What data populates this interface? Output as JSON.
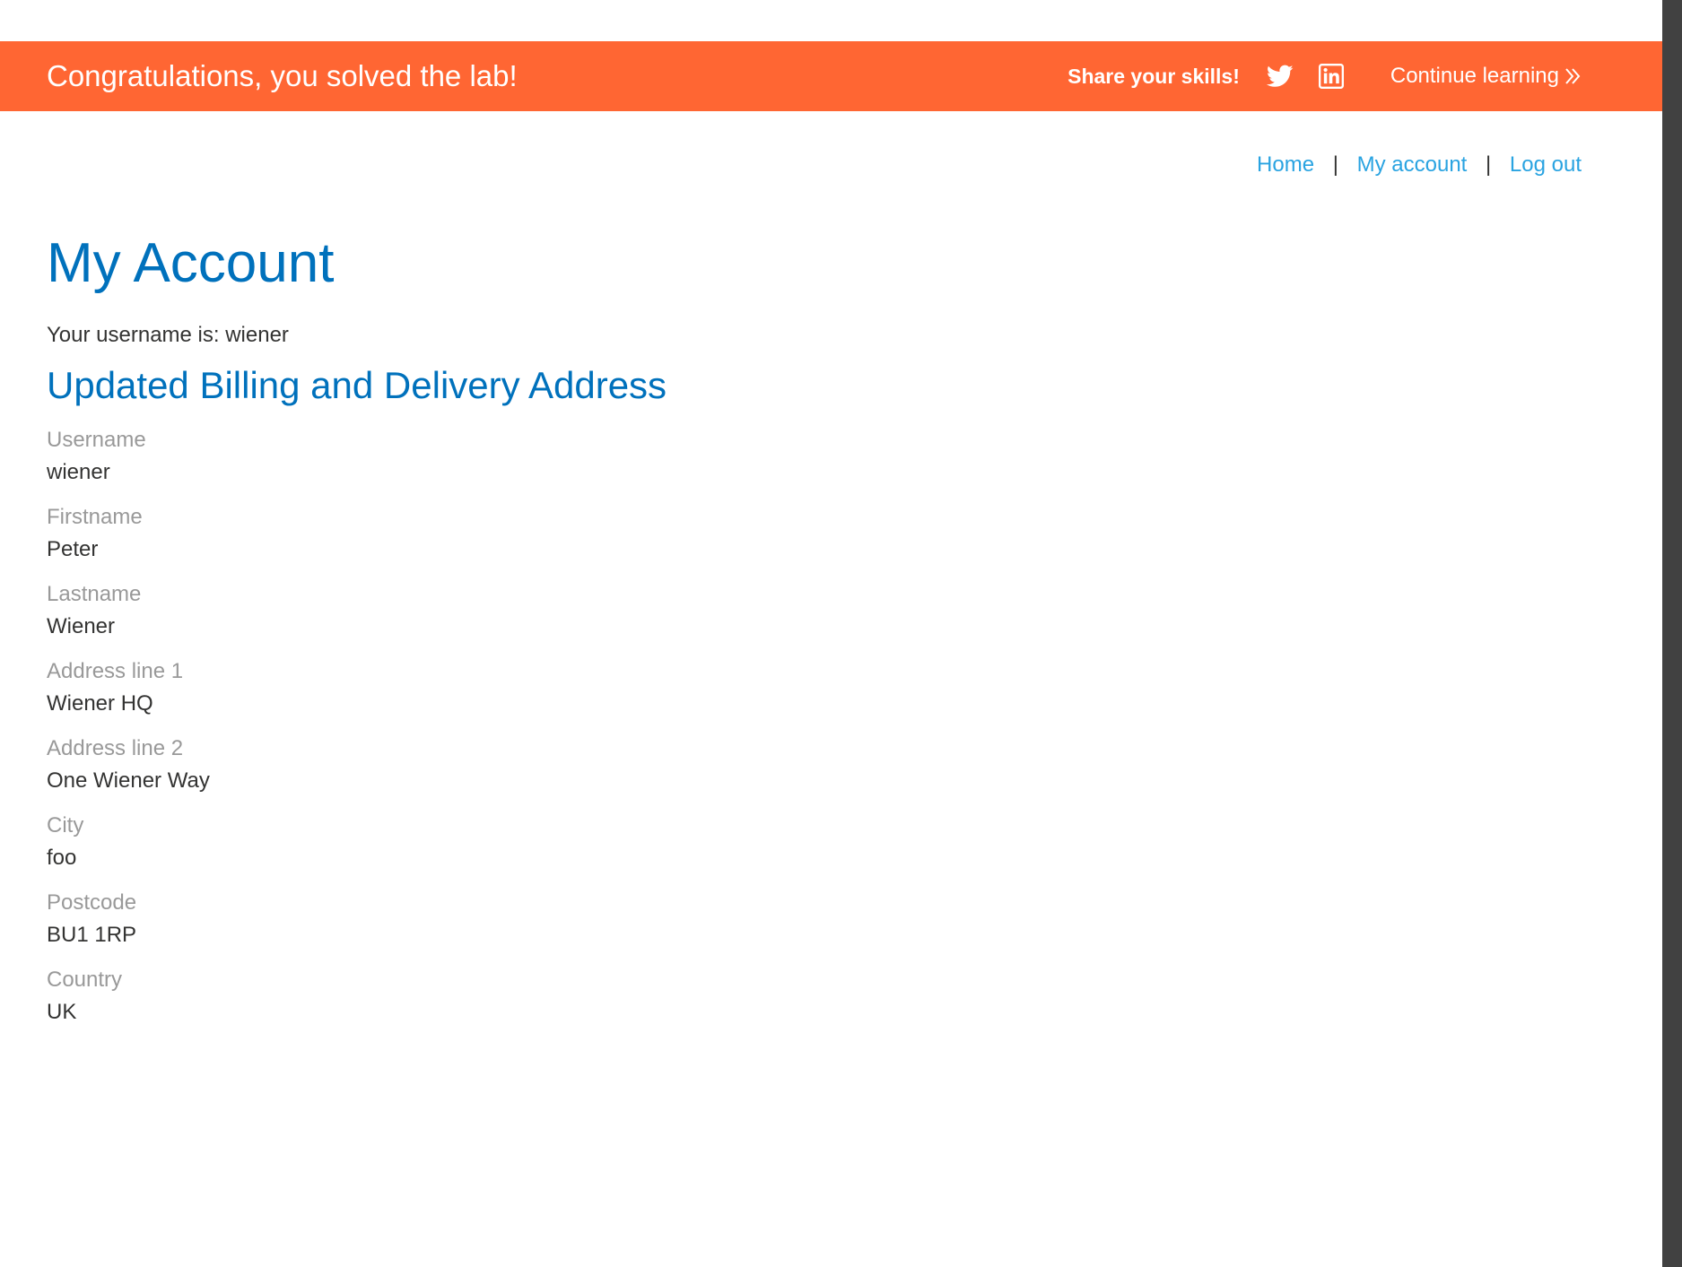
{
  "banner": {
    "title": "Congratulations, you solved the lab!",
    "share_text": "Share your skills!",
    "twitter_icon": "twitter-icon",
    "linkedin_icon": "linkedin-icon",
    "continue_label": "Continue learning",
    "continue_icon": "double-chevron-right-icon",
    "background_color": "#ff6633"
  },
  "nav": {
    "items": [
      {
        "label": "Home"
      },
      {
        "label": "My account"
      },
      {
        "label": "Log out"
      }
    ],
    "separator": "|",
    "link_color": "#29a3e1"
  },
  "main": {
    "page_title": "My Account",
    "username_line": "Your username is: wiener",
    "section_title": "Updated Billing and Delivery Address",
    "heading_color": "#0071bc",
    "fields": [
      {
        "label": "Username",
        "value": "wiener"
      },
      {
        "label": "Firstname",
        "value": "Peter"
      },
      {
        "label": "Lastname",
        "value": "Wiener"
      },
      {
        "label": "Address line 1",
        "value": "Wiener HQ"
      },
      {
        "label": "Address line 2",
        "value": "One Wiener Way"
      },
      {
        "label": "City",
        "value": "foo"
      },
      {
        "label": "Postcode",
        "value": "BU1 1RP"
      },
      {
        "label": "Country",
        "value": "UK"
      }
    ]
  }
}
